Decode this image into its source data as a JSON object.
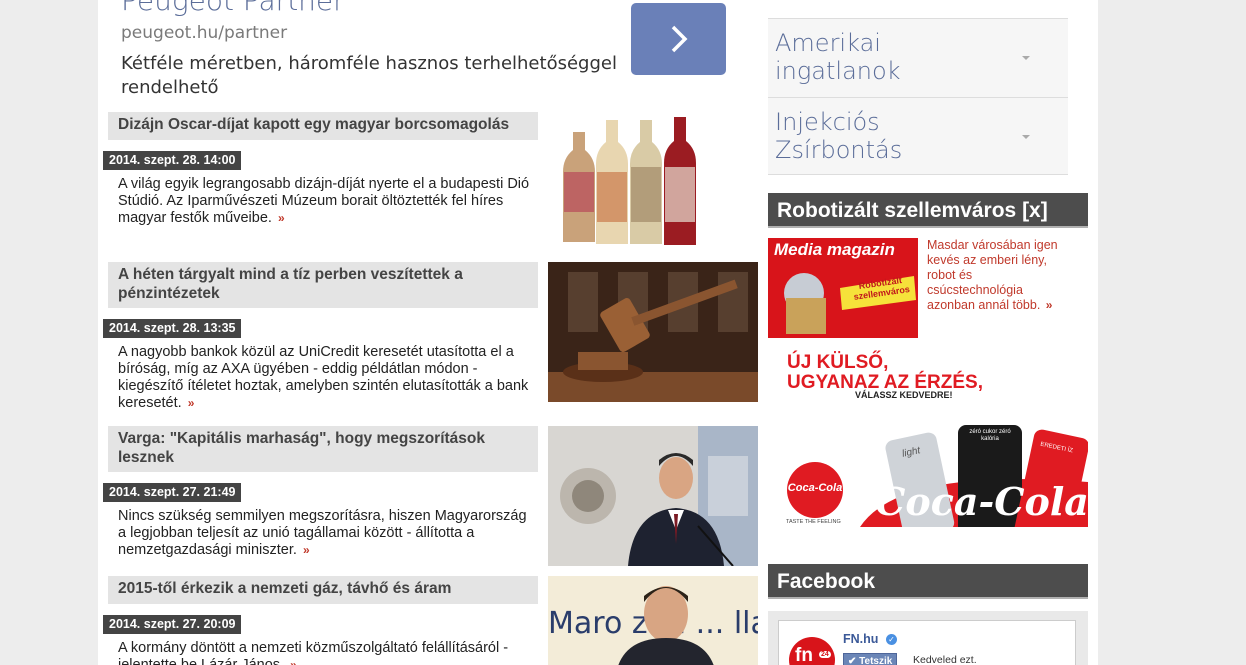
{
  "ad": {
    "title": "Peugeot Partner",
    "url": "peugeot.hu/partner",
    "description": "Kétféle méretben, háromféle hasznos terhelhetőséggel rendelhető"
  },
  "articles": [
    {
      "title": "Dizájn Oscar-díjat kapott egy magyar borcsomagolás",
      "date": "2014. szept. 28. 14:00",
      "excerpt": "A világ egyik legrangosabb dizájn-díját nyerte el a budapesti Dió Stúdió. Az Iparművészeti Múzeum borait öltöztették fel híres magyar festők műveibe.",
      "more": "»"
    },
    {
      "title": "A héten tárgyalt mind a tíz perben veszítettek a pénzintézetek",
      "date": "2014. szept. 28. 13:35",
      "excerpt": "A nagyobb bankok közül az UniCredit keresetét utasította el a bíróság, míg az AXA ügyében - eddig példátlan módon - kiegészítő ítéletet hoztak, amelyben szintén elutasították a bank keresetét.",
      "more": "»"
    },
    {
      "title": "Varga: \"Kapitális marhaság\", hogy megszorítások lesznek",
      "date": "2014. szept. 27. 21:49",
      "excerpt": "Nincs szükség semmilyen megszorításra, hiszen Magyarország a legjobban teljesít az unió tagállamai között - állította a nemzetgazdasági miniszter.",
      "more": "»"
    },
    {
      "title": "2015-től érkezik a nemzeti gáz, távhő és áram",
      "date": "2014. szept. 27. 20:09",
      "excerpt": "A kormány döntött a nemzeti közműszolgáltató felállításáról - jelentette be Lázár János.",
      "more": "»"
    }
  ],
  "ad_list": [
    {
      "label": "Amerikai ingatlanok"
    },
    {
      "label": "Injekciós Zsírbontás"
    }
  ],
  "robot_box": {
    "header": "Robotizált szellemváros [x]",
    "image_brand": "Media magazin",
    "image_sticker": "Robotizált szellemváros",
    "text": "Masdar városában igen kevés az emberi lény, robot és csúcstechnológia azonban annál több.",
    "more": "»"
  },
  "coke_ad": {
    "headline_1": "ÚJ KÜLSŐ,",
    "headline_2": "UGYANAZ AZ ÉRZÉS,",
    "subline": "VÁLASSZ KEDVEDRE!",
    "logo": "Coca-Cola",
    "tagline": "TASTE THE FEELING",
    "can_labels": [
      "light",
      "zéró cukor zéró kalória",
      "EREDETI ÍZ"
    ],
    "wordmark": "Coca-Cola"
  },
  "facebook": {
    "header": "Facebook",
    "page_name": "FN.hu",
    "like_label": "Tetszik",
    "like_text": "Kedveled ezt.",
    "logo_text": "fn",
    "logo_badge": "24"
  },
  "colors": {
    "ad_blue": "#6a80b8",
    "link_red": "#c0392b",
    "header_dark": "#4d4d4d",
    "coke_red": "#e01b22"
  },
  "thumbnail_captions": {
    "lajos_banner": "Maro  zeti ... llalkozók"
  }
}
